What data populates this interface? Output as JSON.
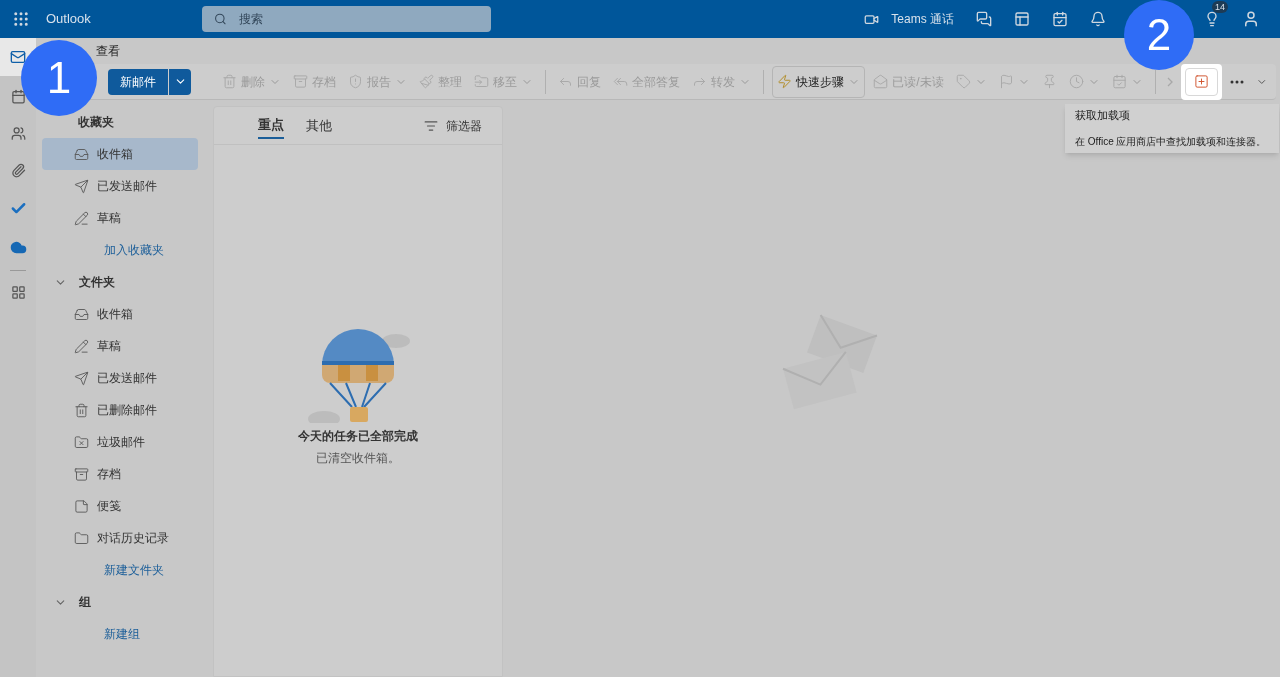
{
  "header": {
    "app_name": "Outlook",
    "search_placeholder": "搜索",
    "teams_label": "Teams 通话",
    "tips_badge": "14"
  },
  "ribbon_tabs": [
    {
      "label": "查看",
      "selected": false
    }
  ],
  "toolbar": {
    "new_mail": "新邮件",
    "items": [
      {
        "kind": "delete",
        "label": "删除",
        "dropdown": true,
        "disabled": true
      },
      {
        "kind": "archive",
        "label": "存档",
        "dropdown": false,
        "disabled": true
      },
      {
        "kind": "report",
        "label": "报告",
        "dropdown": true,
        "disabled": true
      },
      {
        "kind": "sweep",
        "label": "整理",
        "dropdown": false,
        "disabled": true
      },
      {
        "kind": "move",
        "label": "移至",
        "dropdown": true,
        "disabled": true
      },
      {
        "kind": "separator"
      },
      {
        "kind": "reply",
        "label": "回复",
        "dropdown": false,
        "disabled": true
      },
      {
        "kind": "replyall",
        "label": "全部答复",
        "dropdown": false,
        "disabled": true
      },
      {
        "kind": "forward",
        "label": "转发",
        "dropdown": true,
        "disabled": true
      },
      {
        "kind": "separator"
      },
      {
        "kind": "quicksteps",
        "label": "快速步骤",
        "dropdown": true,
        "disabled": false
      },
      {
        "kind": "read",
        "label": "已读/未读",
        "dropdown": false,
        "disabled": true
      },
      {
        "kind": "tag",
        "dropdown": true,
        "disabled": true
      },
      {
        "kind": "flag",
        "dropdown": true,
        "disabled": true
      },
      {
        "kind": "pin",
        "dropdown": false,
        "disabled": true
      },
      {
        "kind": "snooze",
        "dropdown": true,
        "disabled": true
      },
      {
        "kind": "rules",
        "dropdown": true,
        "disabled": true
      },
      {
        "kind": "separator"
      },
      {
        "kind": "next",
        "dropdown": false,
        "disabled": true
      },
      {
        "kind": "addins",
        "dropdown": false,
        "disabled": false,
        "highlighted": true
      },
      {
        "kind": "more",
        "dropdown": false,
        "disabled": false
      }
    ]
  },
  "tooltip": {
    "title": "获取加载项",
    "description": "在 Office 应用商店中查找加载项和连接器。"
  },
  "callouts": [
    "1",
    "2"
  ],
  "nav": {
    "favorites": {
      "title": "收藏夹",
      "items": [
        {
          "kind": "inbox",
          "label": "收件箱",
          "selected": true
        },
        {
          "kind": "sent",
          "label": "已发送邮件",
          "selected": false
        },
        {
          "kind": "drafts",
          "label": "草稿",
          "selected": false
        }
      ],
      "link": "加入收藏夹"
    },
    "folders": {
      "title": "文件夹",
      "expanded": true,
      "items": [
        {
          "kind": "inbox",
          "label": "收件箱",
          "selected": false
        },
        {
          "kind": "drafts",
          "label": "草稿",
          "selected": false
        },
        {
          "kind": "sent",
          "label": "已发送邮件",
          "selected": false
        },
        {
          "kind": "deleted",
          "label": "已删除邮件",
          "selected": false
        },
        {
          "kind": "junk",
          "label": "垃圾邮件",
          "selected": false
        },
        {
          "kind": "archive",
          "label": "存档",
          "selected": false
        },
        {
          "kind": "notes",
          "label": "便笺",
          "selected": false
        },
        {
          "kind": "folder",
          "label": "对话历史记录",
          "selected": false
        }
      ],
      "link": "新建文件夹"
    },
    "groups": {
      "title": "组",
      "expanded": true,
      "link": "新建组"
    }
  },
  "message_list": {
    "tabs": [
      {
        "label": "重点",
        "selected": true
      },
      {
        "label": "其他",
        "selected": false
      }
    ],
    "filter": "筛选器",
    "empty_title": "今天的任务已全部完成",
    "empty_subtitle": "已清空收件箱。"
  }
}
